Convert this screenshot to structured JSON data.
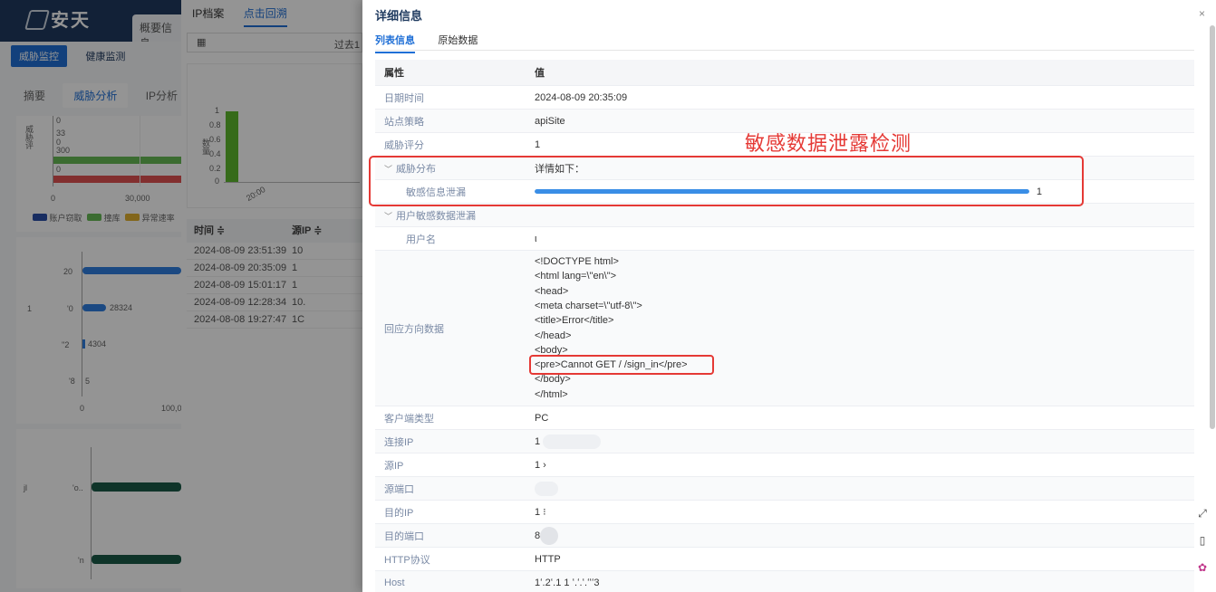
{
  "background": {
    "logo_text": "安天",
    "overview_tab": "概要信息",
    "monitor_tabs": [
      "威胁监控",
      "健康监测"
    ],
    "analysis_tabs": [
      "摘要",
      "威胁分析",
      "IP分析"
    ],
    "chart1": {
      "ylabel": "威胁评",
      "values": [
        "0",
        "33",
        "0",
        "300",
        "0"
      ],
      "axis": [
        "0",
        "30,000"
      ],
      "legend": [
        "账户窃取",
        "撞库",
        "异常速率"
      ]
    },
    "chart2": {
      "labels": [
        "20",
        "'0",
        "''2",
        "'8"
      ],
      "values": [
        "28324",
        "4304",
        "5"
      ],
      "left_labels": [
        "1"
      ],
      "axis": [
        "0",
        "100,0"
      ]
    },
    "chart3": {
      "labels": [
        "jl",
        "'o..",
        "'n"
      ]
    },
    "mid_tabs": [
      "IP档案",
      "点击回溯"
    ],
    "date_text": "过去1",
    "mid_chart": {
      "ylabel": "数量",
      "yticks": [
        "1",
        "0.8",
        "0.6",
        "0.4",
        "0.2",
        "0"
      ],
      "xlabel": "20:00"
    },
    "table": {
      "headers": [
        "时间 ≑",
        "源IP ≑"
      ],
      "rows": [
        [
          "2024-08-09 23:51:39",
          "10"
        ],
        [
          "2024-08-09 20:35:09",
          "1"
        ],
        [
          "2024-08-09 15:01:17",
          "1"
        ],
        [
          "2024-08-09 12:28:34",
          "10."
        ],
        [
          "2024-08-08 19:27:47",
          "1C"
        ]
      ]
    }
  },
  "drawer": {
    "title": "详细信息",
    "close": "×",
    "tabs": [
      "列表信息",
      "原始数据"
    ],
    "header": {
      "key": "属性",
      "value": "值"
    },
    "rows": {
      "date": {
        "key": "日期时间",
        "value": "2024-08-09 20:35:09"
      },
      "site": {
        "key": "站点策略",
        "value": "apiSite"
      },
      "score": {
        "key": "威胁评分",
        "value": "1"
      },
      "dist": {
        "key": "威胁分布",
        "value": "详情如下："
      },
      "sensitive": {
        "key": "敏感信息泄漏",
        "value": "1",
        "fill": 1.0
      },
      "user_leak": {
        "key": "用户敏感数据泄漏",
        "value": ""
      },
      "username": {
        "key": "用户名",
        "value": "ι"
      },
      "response": {
        "key": "回应方向数据",
        "lines": [
          "<!DOCTYPE html>",
          "<html lang=\\\"en\\\">",
          "<head>",
          "<meta charset=\\\"utf-8\\\">",
          "<title>Error</title>",
          "</head>",
          "<body>",
          "<pre>Cannot GET /        /sign_in</pre>",
          "</body>",
          "</html>"
        ]
      },
      "client": {
        "key": "客户端类型",
        "value": "PC"
      },
      "conn_ip": {
        "key": "连接IP",
        "value": "1"
      },
      "src_ip": {
        "key": "源IP",
        "value": "1                ›"
      },
      "src_port": {
        "key": "源端口",
        "value": ""
      },
      "dst_ip": {
        "key": "目的IP",
        "value": "1                ⁝"
      },
      "dst_port": {
        "key": "目的端口",
        "value": "8"
      },
      "http": {
        "key": "HTTP协议",
        "value": "HTTP"
      },
      "host": {
        "key": "Host",
        "value": "1ʻ.2ʻ.1 1 ʻ.ʻ.ʻ.ʻʻʻ3"
      }
    },
    "annotation": "敏感数据泄露检测"
  },
  "colors": {
    "accent": "#1f6fd6",
    "progress": "#3a8ee6",
    "annotation": "#e53935",
    "navy": "#1f3a5f"
  }
}
